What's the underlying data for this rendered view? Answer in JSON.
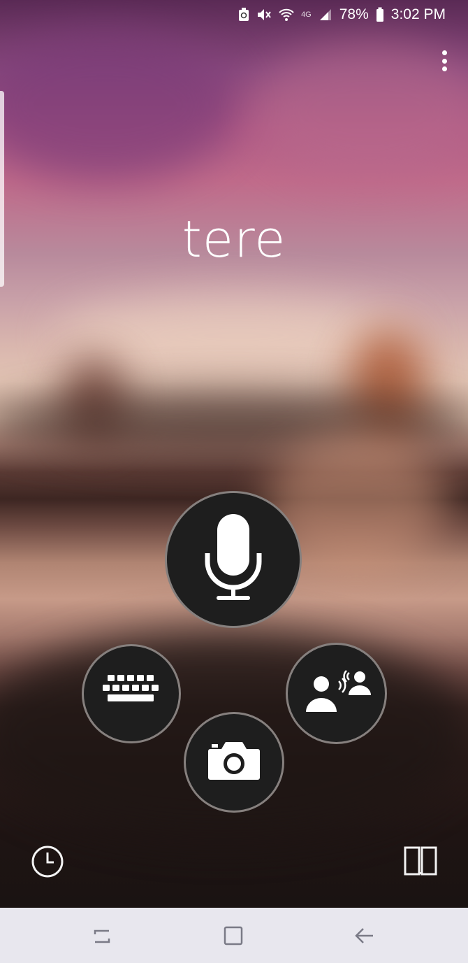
{
  "status_bar": {
    "network": "4G",
    "battery_percent": "78%",
    "time": "3:02 PM"
  },
  "main": {
    "phrase": "tere"
  },
  "icons": {
    "menu": "more-vert-icon",
    "mic": "microphone-icon",
    "keyboard": "keyboard-icon",
    "camera": "camera-icon",
    "conversation": "conversation-icon",
    "history": "history-clock-icon",
    "phrasebook": "phrasebook-icon",
    "nav_recent": "recent-apps-icon",
    "nav_home": "home-icon",
    "nav_back": "back-icon"
  },
  "colors": {
    "button_bg": "#1e1e1e",
    "nav_bar_bg": "#e8e7ee",
    "text": "#ffffff"
  }
}
